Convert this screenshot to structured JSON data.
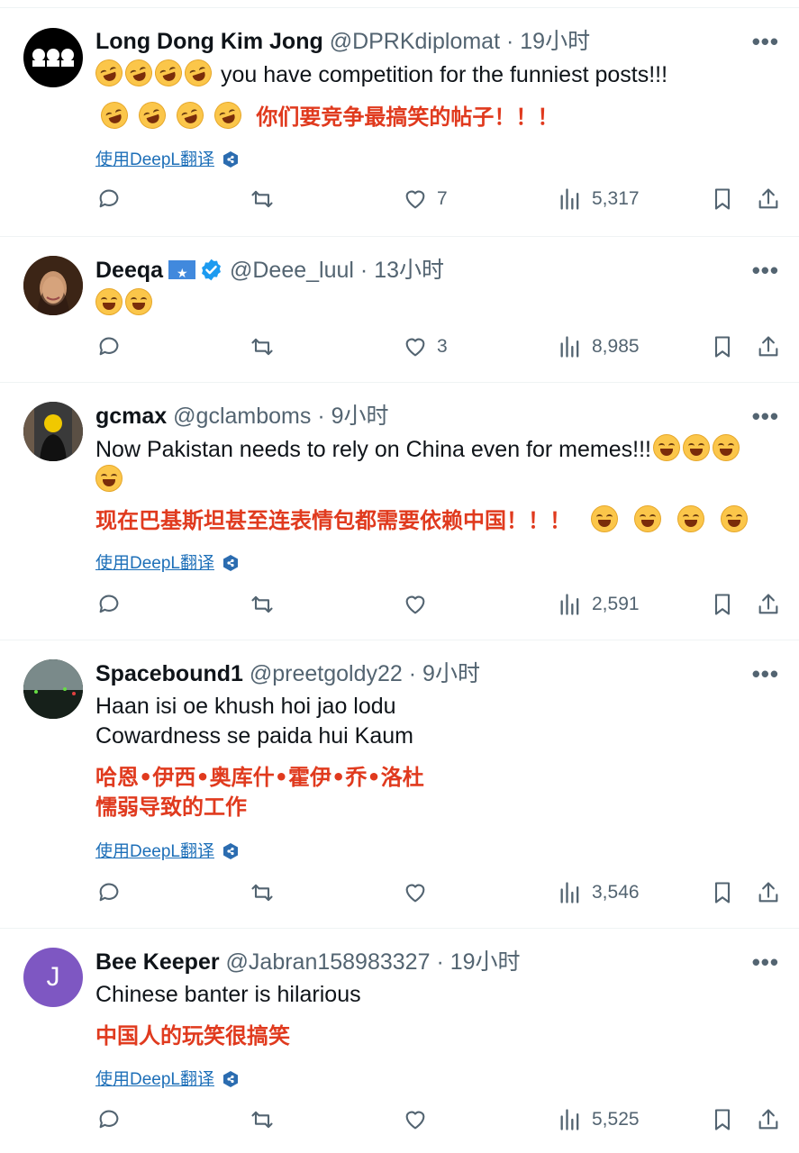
{
  "colors": {
    "link": "#1d6fb8",
    "translation": "#e03a1e",
    "muted": "#536471"
  },
  "translate_label": "使用DeepL翻译",
  "tweets": [
    {
      "name": "Long Dong Kim Jong",
      "handle": "@DPRKdiplomat",
      "sep": "·",
      "time": "19小时",
      "text_lines": [
        "you have competition for the funniest posts!!!"
      ],
      "translation_lines": [
        "你们要竞争最搞笑的帖子！！！"
      ],
      "likes": "7",
      "views": "5,317"
    },
    {
      "name": "Deeqa",
      "handle": "@Deee_luul",
      "sep": "·",
      "time": "13小时",
      "likes": "3",
      "views": "8,985"
    },
    {
      "name": "gcmax",
      "handle": "@gclamboms",
      "sep": "·",
      "time": "9小时",
      "text_lines": [
        "Now Pakistan needs to rely on China even for memes!!!"
      ],
      "translation_lines": [
        "现在巴基斯坦甚至连表情包都需要依赖中国！！！"
      ],
      "likes": "",
      "views": "2,591"
    },
    {
      "name": "Spacebound1",
      "handle": "@preetgoldy22",
      "sep": "·",
      "time": "9小时",
      "text_lines": [
        "Haan isi oe khush hoi jao lodu",
        "Cowardness se paida hui Kaum"
      ],
      "translation_lines": [
        "哈恩•伊西•奥库什•霍伊•乔•洛杜",
        "懦弱导致的工作"
      ],
      "likes": "",
      "views": "3,546"
    },
    {
      "name": "Bee Keeper",
      "handle": "@Jabran158983327",
      "sep": "·",
      "time": "19小时",
      "avatar_letter": "J",
      "text_lines": [
        "Chinese banter is hilarious"
      ],
      "translation_lines": [
        "中国人的玩笑很搞笑"
      ],
      "likes": "",
      "views": "5,525"
    }
  ]
}
